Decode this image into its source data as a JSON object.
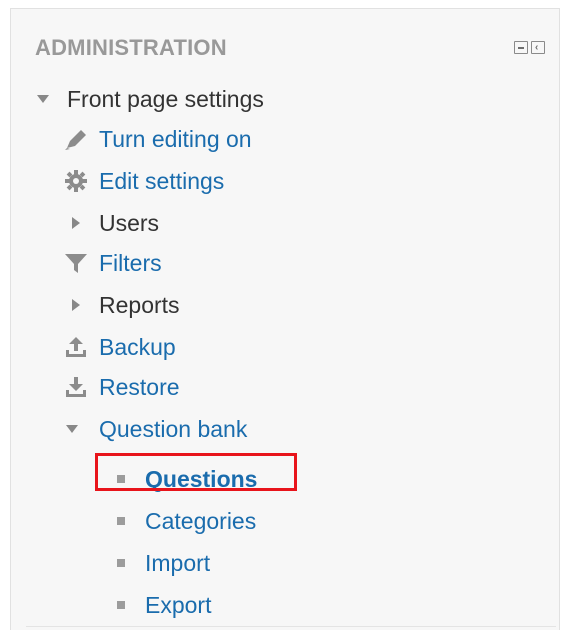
{
  "block": {
    "title": "ADMINISTRATION",
    "controls": [
      {
        "icon": "minus-box-icon"
      },
      {
        "icon": "collapse-left-icon"
      }
    ]
  },
  "tree": {
    "root": {
      "label": "Front page settings",
      "icon": "triangle-down-icon",
      "expanded": true
    },
    "items": [
      {
        "label": "Turn editing on",
        "icon": "pencil-icon"
      },
      {
        "label": "Edit settings",
        "icon": "gear-icon"
      },
      {
        "label": "Users",
        "icon": "triangle-right-icon"
      },
      {
        "label": "Filters",
        "icon": "funnel-icon"
      },
      {
        "label": "Reports",
        "icon": "triangle-right-icon"
      },
      {
        "label": "Backup",
        "icon": "upload-icon"
      },
      {
        "label": "Restore",
        "icon": "download-icon"
      },
      {
        "label": "Question bank",
        "icon": "triangle-down-icon",
        "expanded": true
      }
    ],
    "question_bank_items": [
      {
        "label": "Questions",
        "selected": true,
        "icon": "bullet-icon"
      },
      {
        "label": "Categories",
        "icon": "bullet-icon"
      },
      {
        "label": "Import",
        "icon": "bullet-icon"
      },
      {
        "label": "Export",
        "icon": "bullet-icon"
      }
    ]
  },
  "colors": {
    "link": "#1a6cad",
    "heading": "#999999",
    "text": "#333333",
    "highlight": "#e8141b",
    "panel_bg": "#f7f7f7"
  }
}
